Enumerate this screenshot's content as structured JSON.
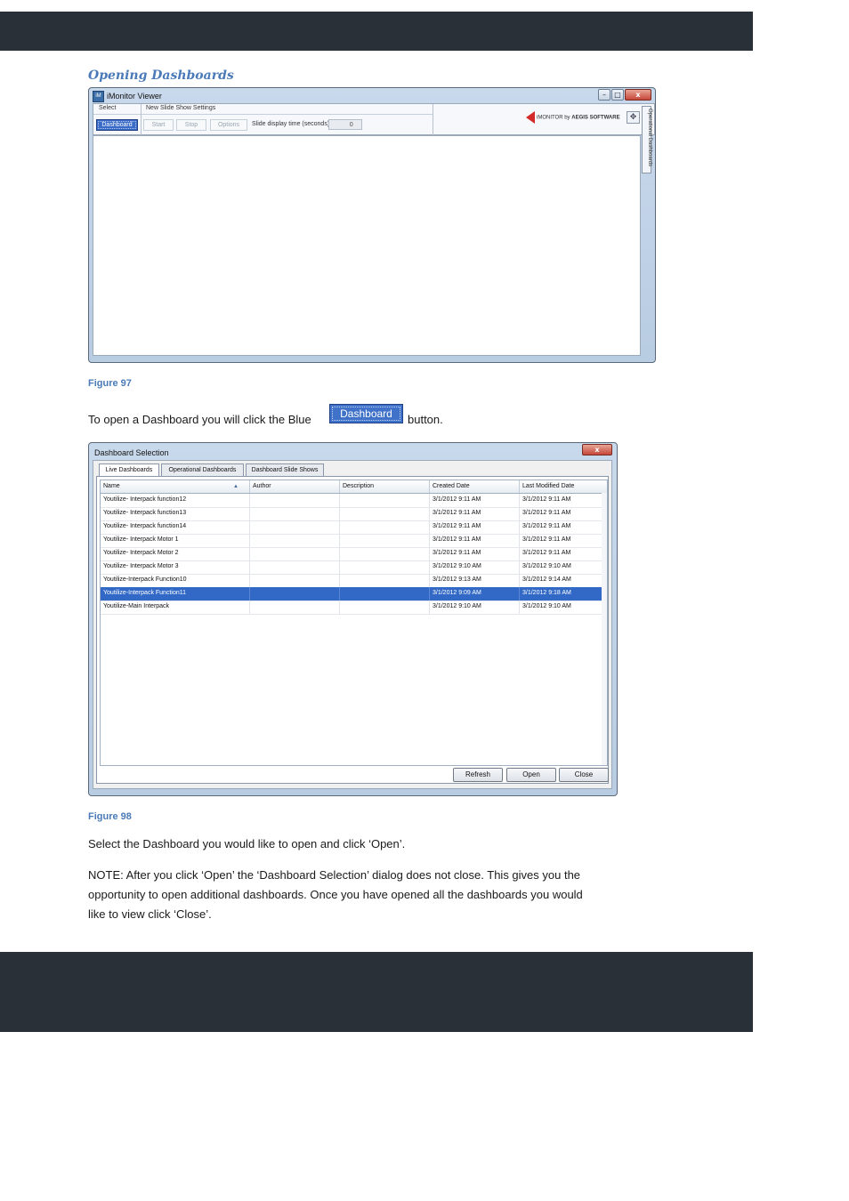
{
  "heading": "Opening Dashboards",
  "viewer": {
    "title": "iMonitor Viewer",
    "window_controls": {
      "minimize": "–",
      "maximize": "□",
      "close": "x"
    },
    "ribbon": {
      "select_header": "Select",
      "dashboard_button": "Dashboard",
      "slideshow_header": "New Slide Show Settings",
      "start": "Start",
      "stop": "Stop",
      "options": "Options",
      "slide_time_label": "Slide display time (seconds):",
      "slide_time_value": "0"
    },
    "brand": {
      "prefix": "iMONITOR by ",
      "bold": "AEGIS SOFTWARE"
    },
    "side_tab": "Operational Dashboards"
  },
  "caption1": "Figure 97",
  "para1_before": "To open a Dashboard you will click the Blue",
  "inline_button": "Dashboard",
  "para1_after": "button.",
  "dialog": {
    "title": "Dashboard Selection",
    "close_glyph": "x",
    "tabs": [
      "Live Dashboards",
      "Operational Dashboards",
      "Dashboard Slide Shows"
    ],
    "columns": [
      "Name",
      "Author",
      "Description",
      "Created Date",
      "Last Modified Date"
    ],
    "sort_glyph": "▲",
    "rows": [
      [
        "Youtilize- Interpack function12",
        "",
        "",
        "3/1/2012 9:11 AM",
        "3/1/2012 9:11 AM"
      ],
      [
        "Youtilize- Interpack function13",
        "",
        "",
        "3/1/2012 9:11 AM",
        "3/1/2012 9:11 AM"
      ],
      [
        "Youtilize- Interpack function14",
        "",
        "",
        "3/1/2012 9:11 AM",
        "3/1/2012 9:11 AM"
      ],
      [
        "Youtilize- Interpack Motor 1",
        "",
        "",
        "3/1/2012 9:11 AM",
        "3/1/2012 9:11 AM"
      ],
      [
        "Youtilize- Interpack Motor 2",
        "",
        "",
        "3/1/2012 9:11 AM",
        "3/1/2012 9:11 AM"
      ],
      [
        "Youtilize- Interpack Motor 3",
        "",
        "",
        "3/1/2012 9:10 AM",
        "3/1/2012 9:10 AM"
      ],
      [
        "Youtilize-Interpack Function10",
        "",
        "",
        "3/1/2012 9:13 AM",
        "3/1/2012 9:14 AM"
      ],
      [
        "Youtilize-Interpack Function11",
        "",
        "",
        "3/1/2012 9:09 AM",
        "3/1/2012 9:18 AM"
      ],
      [
        "Youtilize-Main Interpack",
        "",
        "",
        "3/1/2012 9:10 AM",
        "3/1/2012 9:10 AM"
      ]
    ],
    "selected_row": 7,
    "buttons": {
      "refresh": "Refresh",
      "open": "Open",
      "close": "Close"
    }
  },
  "caption2": "Figure 98",
  "para2": "Select the Dashboard you would like to open and click ‘Open’.",
  "note_lines": [
    "NOTE:  After you click ‘Open’ the ‘Dashboard Selection’ dialog does not close.  This gives you the",
    "opportunity to open additional dashboards.  Once you have opened all the dashboards you would",
    "like to view click ‘Close’."
  ],
  "colors": {
    "bar": "#2a3038",
    "accent": "#4a7ab8",
    "selection": "#3369c6"
  }
}
